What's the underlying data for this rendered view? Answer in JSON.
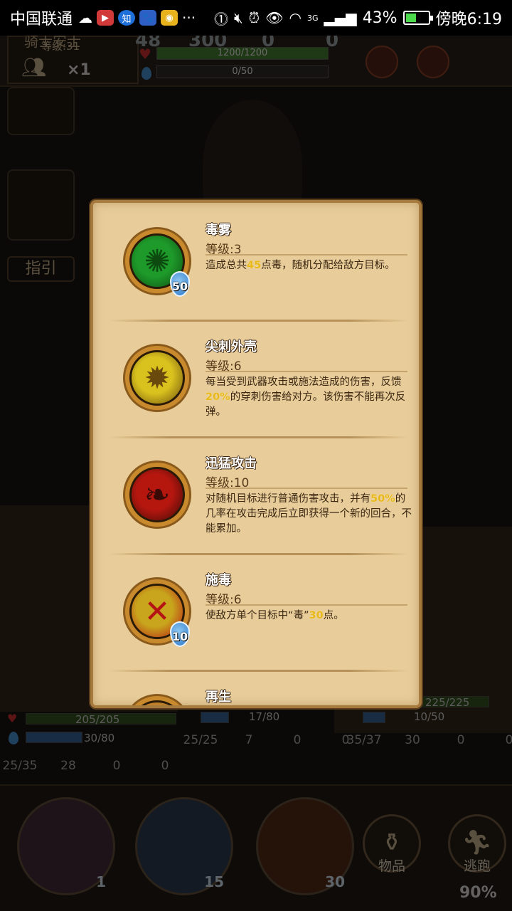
{
  "status_bar": {
    "carrier": "中国联通",
    "zhihu_label": "知",
    "more": "···",
    "network": "3G",
    "battery_pct": "43%",
    "battery_level": 0.43,
    "time": "傍晚6:19"
  },
  "hud": {
    "hero_name": "骑士安士",
    "level": "等级:31",
    "party_count": "×1",
    "res_left": "48",
    "res_mid": "300",
    "res_right_a": "0",
    "res_right_b": "0",
    "hp": "1200/1200",
    "hp_fraction": 1.0,
    "mp": "0/50",
    "mp_fraction": 0.0,
    "guide": "指引"
  },
  "units": {
    "left": {
      "hp": "205/205",
      "mp": "30/80",
      "armor": "25/35",
      "shield": "28",
      "skull": "0",
      "blood": "0"
    },
    "middle": {
      "mp": "17/80",
      "armor": "25/25",
      "shield": "7",
      "skull": "0",
      "blood": "0"
    },
    "right": {
      "hp": "225/225",
      "mp": "10/50",
      "armor": "35/37",
      "shield": "30",
      "skull": "0",
      "blood": "0"
    }
  },
  "action_bar": {
    "slot1_count": "1",
    "slot2_cost": "15",
    "slot3_cost": "30",
    "items_label": "物品",
    "flee_label": "逃跑",
    "flee_pct": "90%"
  },
  "popup": {
    "skills": [
      {
        "name": "毒雾",
        "level": "等级:3",
        "cost": "50",
        "desc_parts": [
          "造成总共",
          "45",
          "点毒，随机分配给敌方目标。"
        ],
        "colors": {
          "core": "#1e9a2a",
          "accent": "#0c4a10"
        }
      },
      {
        "name": "尖刺外壳",
        "level": "等级:6",
        "cost": "",
        "desc_parts": [
          "每当受到武器攻击或施法造成的伤害，反馈",
          "20%",
          "的穿刺伤害给对方。该伤害不能再次反弹。"
        ],
        "colors": {
          "core": "#d9c21e",
          "accent": "#6a4a0c"
        }
      },
      {
        "name": "迅猛攻击",
        "level": "等级:10",
        "cost": "",
        "desc_parts": [
          "对随机目标进行普通伤害攻击，并有",
          "50%",
          "的几率在攻击完成后立即获得一个新的回合，不能累加。"
        ],
        "colors": {
          "core": "#b5170f",
          "accent": "#3a0a06"
        }
      },
      {
        "name": "施毒",
        "level": "等级:6",
        "cost": "10",
        "desc_parts": [
          "使敌方单个目标中“毒”",
          "30",
          "点。"
        ],
        "colors": {
          "core": "#c8a51c",
          "accent": "#b51414"
        }
      },
      {
        "name": "再生",
        "level": "",
        "cost": "",
        "desc_parts": [
          "",
          "",
          ""
        ],
        "colors": {
          "core": "#c98a2e",
          "accent": "#8a5a1c"
        }
      }
    ]
  }
}
